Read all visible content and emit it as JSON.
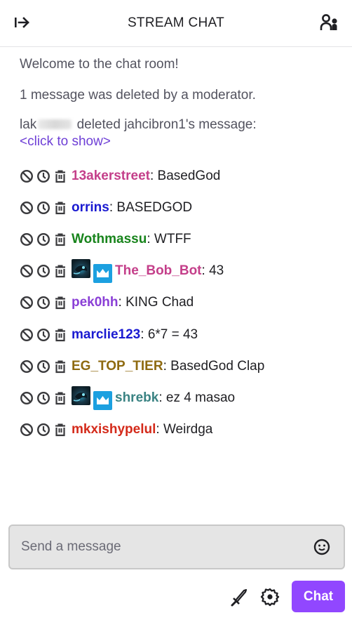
{
  "header": {
    "title": "STREAM CHAT",
    "collapse_icon": "arrow-right-to-bar-icon",
    "community_icon": "users-icon"
  },
  "system": {
    "welcome": "Welcome to the chat room!",
    "deleted_notice": "1 message was deleted by a moderator.",
    "deleter_prefix": "lak",
    "deleted_suffix": "deleted jahcibron1's message:",
    "click_to_show": "<click to show>"
  },
  "mod_icons": [
    "ban-icon",
    "timeout-icon",
    "delete-icon"
  ],
  "messages": [
    {
      "username": "13akerstreet",
      "color": "#c43f8a",
      "text": "BasedGod",
      "badges": []
    },
    {
      "username": "orrins",
      "color": "#1a1ad1",
      "text": "BASEDGOD",
      "badges": []
    },
    {
      "username": "Wothmassu",
      "color": "#18841c",
      "text": "WTFF",
      "badges": []
    },
    {
      "username": "The_Bob_Bot",
      "color": "#c43f8a",
      "text": "43",
      "badges": [
        "avatar",
        "subscriber-crown"
      ]
    },
    {
      "username": "pek0hh",
      "color": "#8a3fd6",
      "text": "KING Chad",
      "badges": []
    },
    {
      "username": "marclie123",
      "color": "#1a1ad1",
      "text": "6*7 = 43",
      "badges": []
    },
    {
      "username": "EG_TOP_TIER",
      "color": "#8e6a10",
      "text": "BasedGod Clap",
      "badges": []
    },
    {
      "username": "shrebk",
      "color": "#3a8383",
      "text": "ez 4 masao",
      "badges": [
        "avatar",
        "subscriber-crown"
      ]
    },
    {
      "username": "mkxishypelul",
      "color": "#d42a1a",
      "text": "Weirdga",
      "badges": []
    }
  ],
  "composer": {
    "placeholder": "Send a message",
    "value": "",
    "emote_icon": "smiley-icon"
  },
  "bottom_bar": {
    "mod_tools_icon": "sword-icon",
    "settings_icon": "gear-icon",
    "chat_button_label": "Chat"
  },
  "colors": {
    "accent": "#9147ff",
    "link": "#6e3fd6",
    "subscriber_badge": "#1ca0e0"
  }
}
